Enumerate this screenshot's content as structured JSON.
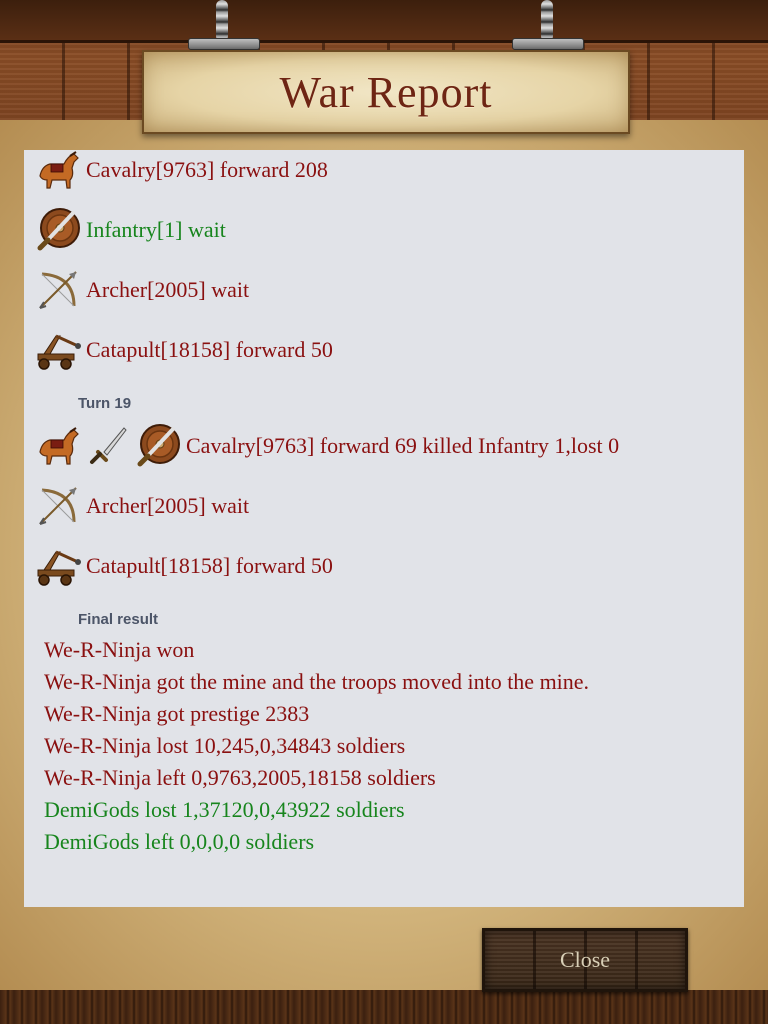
{
  "header": {
    "title": "War Report"
  },
  "log": [
    {
      "type": "row",
      "icons": [
        "horse-icon"
      ],
      "text": "Cavalry[9763] forward 208",
      "color": "red"
    },
    {
      "type": "row",
      "icons": [
        "shield-sword-icon"
      ],
      "text": "Infantry[1] wait",
      "color": "green"
    },
    {
      "type": "row",
      "icons": [
        "bow-arrow-icon"
      ],
      "text": "Archer[2005] wait",
      "color": "red"
    },
    {
      "type": "row",
      "icons": [
        "catapult-icon"
      ],
      "text": "Catapult[18158] forward 50",
      "color": "red"
    },
    {
      "type": "section",
      "text": "Turn 19"
    },
    {
      "type": "row",
      "icons": [
        "horse-icon",
        "sword-icon",
        "shield-sword-icon"
      ],
      "text": "Cavalry[9763] forward 69 killed Infantry 1,lost 0",
      "color": "red"
    },
    {
      "type": "row",
      "icons": [
        "bow-arrow-icon"
      ],
      "text": "Archer[2005] wait",
      "color": "red"
    },
    {
      "type": "row",
      "icons": [
        "catapult-icon"
      ],
      "text": "Catapult[18158] forward 50",
      "color": "red"
    },
    {
      "type": "section",
      "text": "Final result"
    }
  ],
  "final_result": [
    {
      "text": "We-R-Ninja won",
      "color": "red"
    },
    {
      "text": "We-R-Ninja got the mine and the troops moved into the mine.",
      "color": "red"
    },
    {
      "text": "We-R-Ninja got prestige 2383",
      "color": "red"
    },
    {
      "text": "We-R-Ninja lost 10,245,0,34843 soldiers",
      "color": "red"
    },
    {
      "text": "We-R-Ninja left 0,9763,2005,18158 soldiers",
      "color": "red"
    },
    {
      "text": "DemiGods lost 1,37120,0,43922 soldiers",
      "color": "green"
    },
    {
      "text": "DemiGods left 0,0,0,0 soldiers",
      "color": "green"
    }
  ],
  "colors": {
    "red_text": "#8a1010",
    "green_text": "#17851d",
    "section_label": "#4c5568",
    "title": "#6e2514"
  },
  "footer": {
    "close_label": "Close"
  }
}
